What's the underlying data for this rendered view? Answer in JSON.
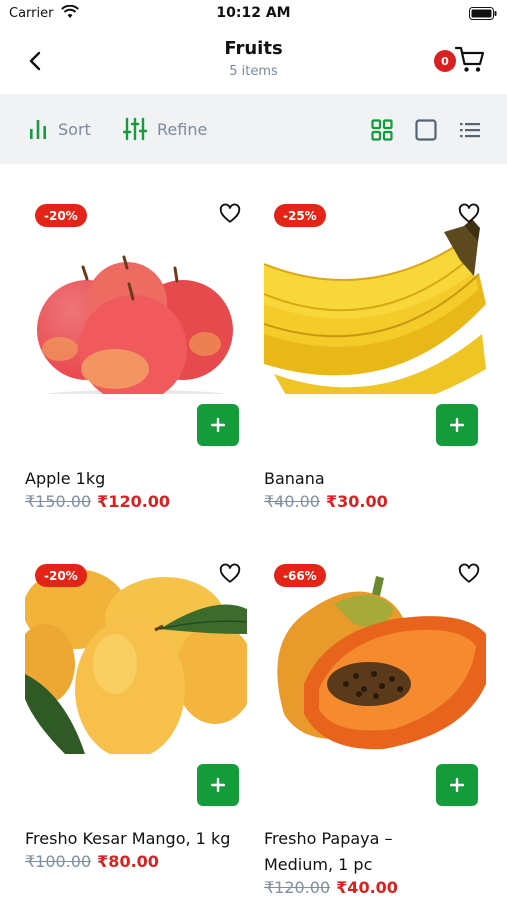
{
  "status_bar": {
    "carrier": "Carrier",
    "time": "10:12 AM"
  },
  "header": {
    "title": "Fruits",
    "subtitle": "5 items",
    "cart_count": "0"
  },
  "toolbar": {
    "sort_label": "Sort",
    "refine_label": "Refine"
  },
  "colors": {
    "accent_green": "#149b3a",
    "discount_red": "#e42417",
    "price_red": "#d92121"
  },
  "products": [
    {
      "name": "Apple 1kg",
      "discount": "-20%",
      "old_price": "₹150.00",
      "price": "₹120.00"
    },
    {
      "name": "Banana",
      "discount": "-25%",
      "old_price": "₹40.00",
      "price": "₹30.00"
    },
    {
      "name": "Fresho Kesar Mango, 1 kg",
      "discount": "-20%",
      "old_price": "₹100.00",
      "price": "₹80.00"
    },
    {
      "name": "Fresho Papaya – Medium, 1 pc",
      "discount": "-66%",
      "old_price": "₹120.00",
      "price": "₹40.00"
    }
  ]
}
